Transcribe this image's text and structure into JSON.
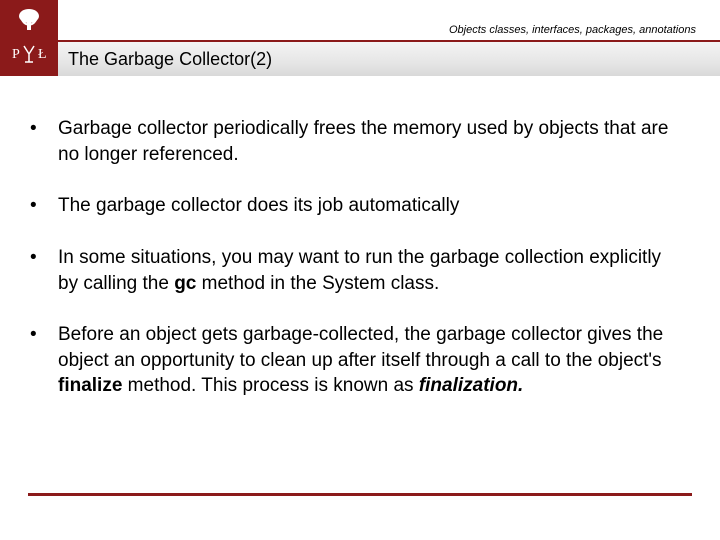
{
  "header": {
    "breadcrumb": "Objects classes, interfaces, packages, annotations"
  },
  "title": "The Garbage Collector(2)",
  "logo": {
    "left_letter": "P",
    "right_letter": "Ł"
  },
  "bullets": [
    {
      "html": "Garbage collector  periodically frees the memory used by objects that are no longer referenced."
    },
    {
      "html": "The garbage collector does its job automatically"
    },
    {
      "html": "In some situations, you may want to run the garbage collection explicitly by calling the <b>gc</b> method in the System class."
    },
    {
      "html": "Before an object gets garbage-collected, the garbage collector gives the object an opportunity to clean up after itself through a call to the object's <b>finalize</b> method. This process is known as <b><i>finalization.</i></b>"
    }
  ]
}
